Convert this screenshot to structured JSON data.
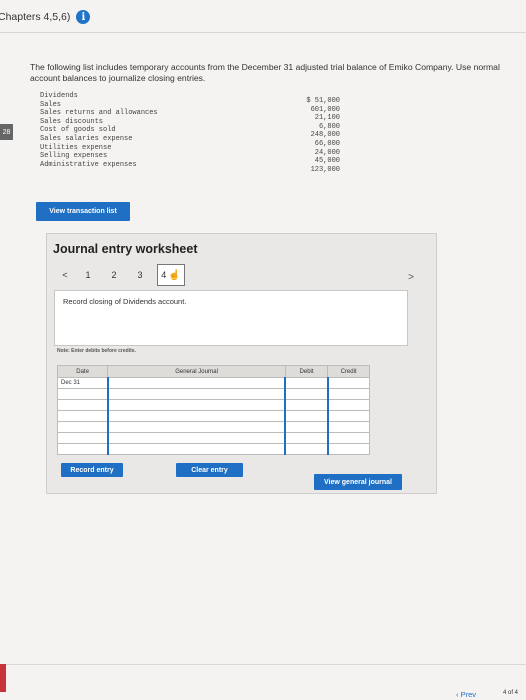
{
  "header": {
    "title": "Chapters 4,5,6)",
    "info_icon": "info-icon"
  },
  "side_tab_label": "28",
  "intro": "The following list includes temporary accounts from the December 31 adjusted trial balance of Emiko Company. Use normal account balances to journalize closing entries.",
  "accounts": [
    {
      "name": "Dividends",
      "amount": "$ 51,000"
    },
    {
      "name": "Sales",
      "amount": "601,000"
    },
    {
      "name": "Sales returns and allowances",
      "amount": "21,100"
    },
    {
      "name": "Sales discounts",
      "amount": "6,800"
    },
    {
      "name": "Cost of goods sold",
      "amount": "248,000"
    },
    {
      "name": "Sales salaries expense",
      "amount": "66,000"
    },
    {
      "name": "Utilities expense",
      "amount": "24,000"
    },
    {
      "name": "Selling expenses",
      "amount": "45,000"
    },
    {
      "name": "Administrative expenses",
      "amount": "123,000"
    }
  ],
  "buttons": {
    "view_transaction_list": "View transaction list",
    "record_entry": "Record entry",
    "clear_entry": "Clear entry",
    "view_general_journal": "View general journal"
  },
  "worksheet": {
    "title": "Journal entry worksheet",
    "prev_arrow": "<",
    "next_arrow": ">",
    "steps": [
      "1",
      "2",
      "3",
      "4"
    ],
    "active_step": "4",
    "description": "Record closing of Dividends account.",
    "note": "Note: Enter debits before credits.",
    "table": {
      "headers": {
        "date": "Date",
        "general_journal": "General Journal",
        "debit": "Debit",
        "credit": "Credit"
      },
      "first_date": "Dec 31",
      "row_count": 7
    }
  },
  "footer": {
    "prev": "Prev",
    "page": "4 of 4"
  }
}
